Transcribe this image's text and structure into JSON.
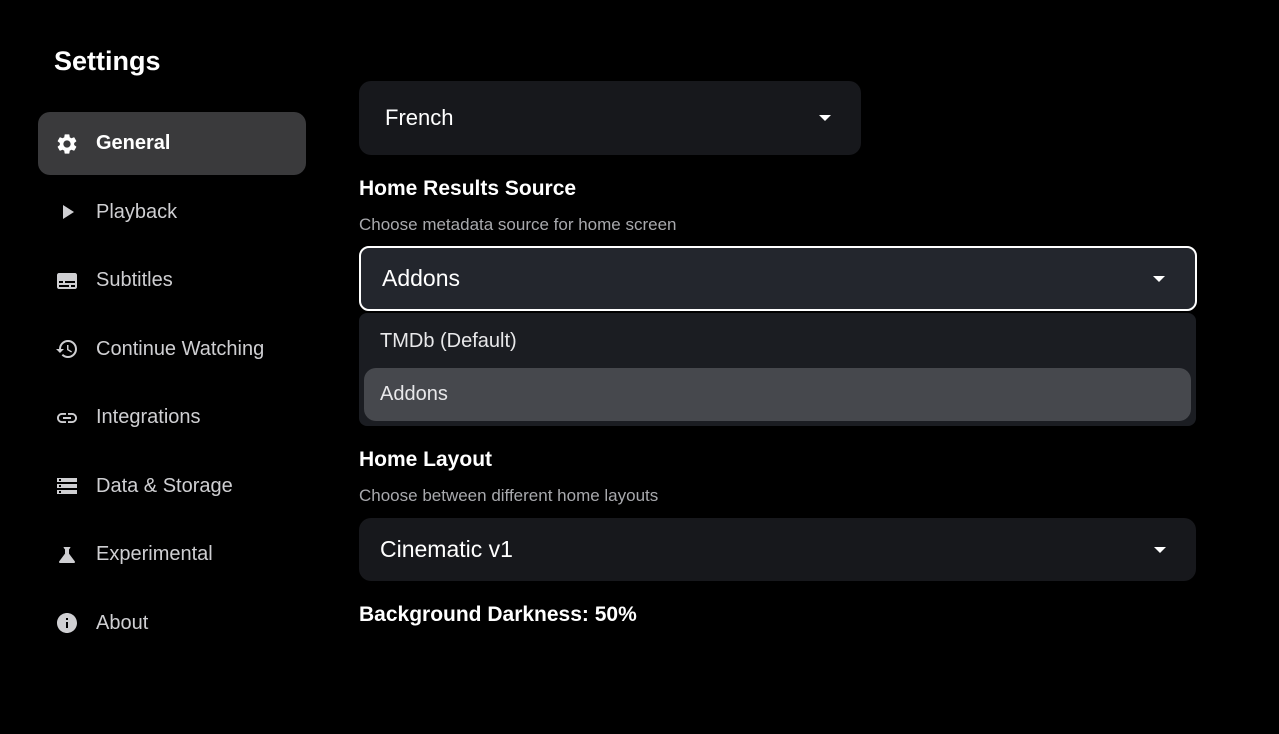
{
  "sidebar": {
    "title": "Settings",
    "items": [
      {
        "label": "General",
        "icon": "gear-icon",
        "active": true
      },
      {
        "label": "Playback",
        "icon": "play-icon",
        "active": false
      },
      {
        "label": "Subtitles",
        "icon": "subtitles-icon",
        "active": false
      },
      {
        "label": "Continue Watching",
        "icon": "history-icon",
        "active": false
      },
      {
        "label": "Integrations",
        "icon": "link-icon",
        "active": false
      },
      {
        "label": "Data & Storage",
        "icon": "storage-icon",
        "active": false
      },
      {
        "label": "Experimental",
        "icon": "flask-icon",
        "active": false
      },
      {
        "label": "About",
        "icon": "info-icon",
        "active": false
      }
    ]
  },
  "main": {
    "language": {
      "value": "French"
    },
    "home_results_source": {
      "title": "Home Results Source",
      "subtitle": "Choose metadata source for home screen",
      "value": "Addons",
      "options": [
        {
          "label": "TMDb (Default)",
          "selected": false
        },
        {
          "label": "Addons",
          "selected": true
        }
      ]
    },
    "home_layout": {
      "title": "Home Layout",
      "subtitle": "Choose between different home layouts",
      "value": "Cinematic v1"
    },
    "background_darkness": {
      "label": "Background Darkness: 50%"
    }
  },
  "colors": {
    "background": "#000000",
    "active_nav": "#3a3a3c",
    "field": "#17181c",
    "focused_field": "#23262d",
    "menu_selected": "#46484d"
  }
}
